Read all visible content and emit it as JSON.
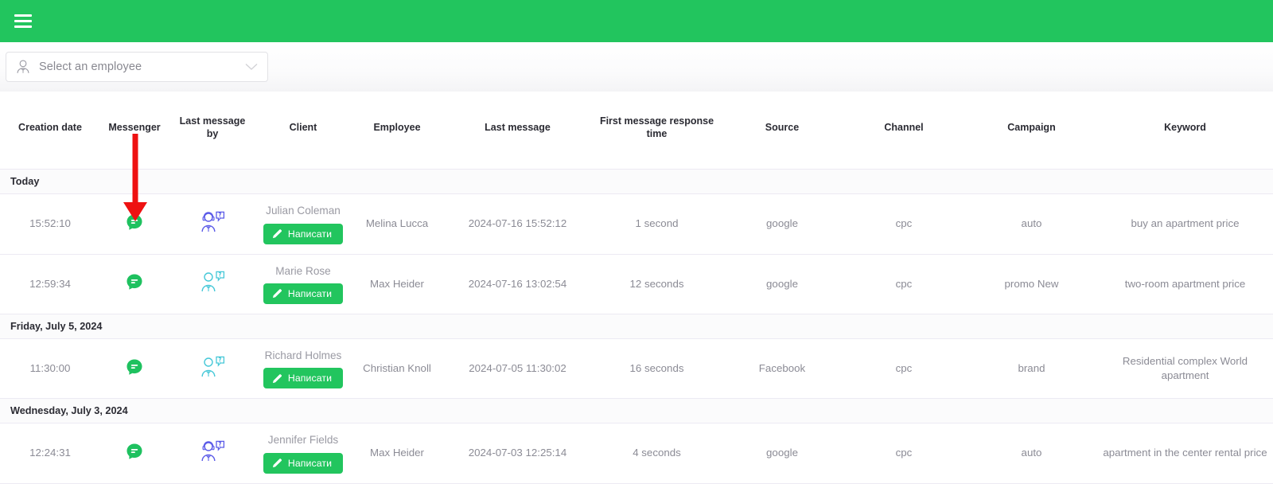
{
  "topbar": {
    "menu_icon": "hamburger-menu-icon",
    "color": "#22c55e"
  },
  "filter": {
    "employee_select_placeholder": "Select an employee",
    "employee_icon": "employee-avatar-icon",
    "dropdown_icon": "chevron-down-icon"
  },
  "table": {
    "columns": [
      "Creation date",
      "Messenger",
      "Last message by",
      "Client",
      "Employee",
      "Last message",
      "First message response time",
      "Source",
      "Channel",
      "Campaign",
      "Keyword"
    ],
    "write_button_label": "Написати",
    "groups": [
      {
        "label": "Today",
        "rows": [
          {
            "creation_date": "15:52:10",
            "messenger": "google-business-messages-icon",
            "last_message_by": "operator-headset-icon",
            "client": "Julian Coleman",
            "employee": "Melina Lucca",
            "last_message": "2024-07-16 15:52:12",
            "first_response": "1 second",
            "source": "google",
            "channel": "cpc",
            "campaign": "auto",
            "keyword": "buy an apartment price"
          },
          {
            "creation_date": "12:59:34",
            "messenger": "google-business-messages-icon",
            "last_message_by": "client-person-icon",
            "client": "Marie Rose",
            "employee": "Max Heider",
            "last_message": "2024-07-16 13:02:54",
            "first_response": "12 seconds",
            "source": "google",
            "channel": "cpc",
            "campaign": "promo New",
            "keyword": "two-room apartment price"
          }
        ]
      },
      {
        "label": "Friday, July 5, 2024",
        "rows": [
          {
            "creation_date": "11:30:00",
            "messenger": "google-business-messages-icon",
            "last_message_by": "client-person-icon",
            "client": "Richard Holmes",
            "employee": "Christian Knoll",
            "last_message": "2024-07-05 11:30:02",
            "first_response": "16 seconds",
            "source": "Facebook",
            "channel": "cpc",
            "campaign": "brand",
            "keyword": "Residential complex World apartment"
          }
        ]
      },
      {
        "label": "Wednesday, July 3, 2024",
        "rows": [
          {
            "creation_date": "12:24:31",
            "messenger": "google-business-messages-icon",
            "last_message_by": "operator-headset-icon",
            "client": "Jennifer Fields",
            "employee": "Max Heider",
            "last_message": "2024-07-03 12:25:14",
            "first_response": "4 seconds",
            "source": "google",
            "channel": "cpc",
            "campaign": "auto",
            "keyword": "apartment in the center rental price"
          }
        ]
      }
    ]
  },
  "annotation": {
    "arrow_color": "#ee1111",
    "points_to": "messenger-column-icon"
  }
}
